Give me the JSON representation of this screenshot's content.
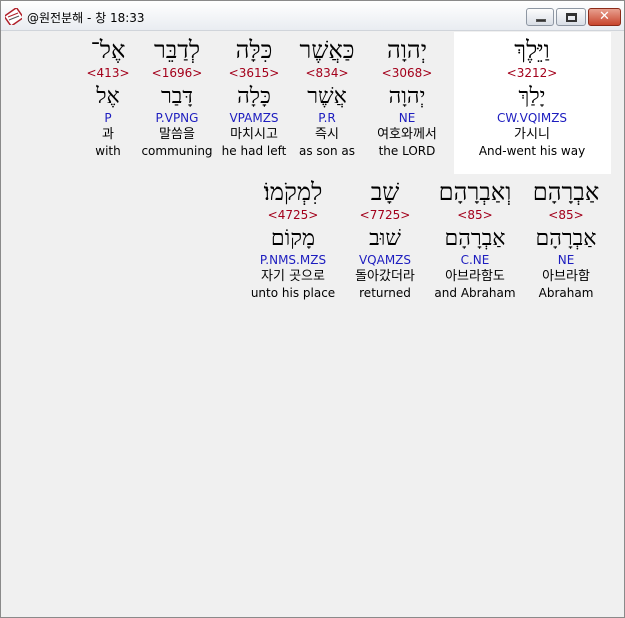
{
  "window": {
    "title": "@원전분해 - 창 18:33",
    "icon": "app-book-icon",
    "controls": {
      "minimize": "minimize-icon",
      "maximize": "maximize-icon",
      "close": "✕"
    }
  },
  "rows": [
    {
      "words": [
        {
          "heb": "וַיֵּלֶךְ",
          "strong": "<3212>",
          "lemma": "יָלַךְ",
          "morph": "CW.VQIMZS",
          "kor": "가시니",
          "eng": "And-went his way",
          "selected": true
        },
        {
          "heb": "יְהוָה",
          "strong": "<3068>",
          "lemma": "יְהוָה",
          "morph": "NE",
          "kor": "여호와께서",
          "eng": "the LORD"
        },
        {
          "heb": "כַּאֲשֶׁר",
          "strong": "<834>",
          "lemma": "אֲשֶׁר",
          "morph": "P.R",
          "kor": "즉시",
          "eng": "as son as"
        },
        {
          "heb": "כִּלָּה",
          "strong": "<3615>",
          "lemma": "כָּלָה",
          "morph": "VPAMZS",
          "kor": "마치시고",
          "eng": "he had left"
        },
        {
          "heb": "לְדַבֵּר",
          "strong": "<1696>",
          "lemma": "דָּבַר",
          "morph": "P.VPNG",
          "kor": "말씀을",
          "eng": "communing"
        },
        {
          "heb": "אֶל־",
          "strong": "<413>",
          "lemma": "אֶל",
          "morph": "P",
          "kor": "과",
          "eng": "with"
        }
      ]
    },
    {
      "words": [
        {
          "heb": "אַבְרָהָם",
          "strong": "<85>",
          "lemma": "אַבְרָהָם",
          "morph": "NE",
          "kor": "아브라함",
          "eng": "Abraham"
        },
        {
          "heb": "וְאַבְרָהָם",
          "strong": "<85>",
          "lemma": "אַבְרָהָם",
          "morph": "C.NE",
          "kor": "아브라함도",
          "eng": "and Abraham"
        },
        {
          "heb": "שָׁב",
          "strong": "<7725>",
          "lemma": "שׁוּב",
          "morph": "VQAMZS",
          "kor": "돌아갔더라",
          "eng": "returned"
        },
        {
          "heb": "לִמְקֹמוֹ׃",
          "strong": "<4725>",
          "lemma": "מָקוֹם",
          "morph": "P.NMS.MZS",
          "kor": "자기 곳으로",
          "eng": "unto his place"
        }
      ]
    }
  ]
}
